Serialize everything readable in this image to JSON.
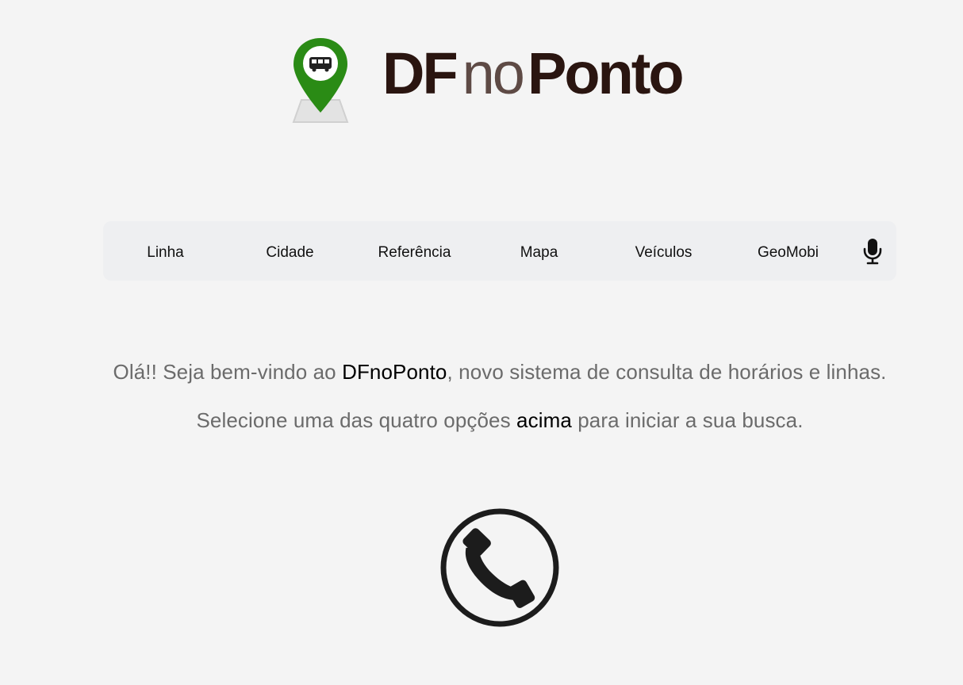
{
  "logo": {
    "part1": "DF",
    "part2": "no",
    "part3": "Ponto",
    "icon": "bus-map-pin-icon",
    "pin_color": "#2a8b15"
  },
  "nav": {
    "items": [
      {
        "label": "Linha"
      },
      {
        "label": "Cidade"
      },
      {
        "label": "Referência"
      },
      {
        "label": "Mapa"
      },
      {
        "label": "Veículos"
      },
      {
        "label": "GeoMobi"
      }
    ],
    "voice_icon": "microphone-icon"
  },
  "welcome": {
    "line1_pre": "Olá!! Seja bem-vindo ao ",
    "line1_brand": "DFnoPonto",
    "line1_post": ", novo sistema de consulta de horários e linhas.",
    "line2_pre": "Selecione uma das quatro opções ",
    "line2_hl": "acima",
    "line2_post": " para iniciar a sua busca."
  },
  "contact": {
    "icon": "phone-icon"
  },
  "colors": {
    "background": "#f4f4f4",
    "navbar": "#eeeff1",
    "brand_dark": "#2a1510",
    "brand_mid": "#5e4a45",
    "text_muted": "#6b6b6b"
  }
}
